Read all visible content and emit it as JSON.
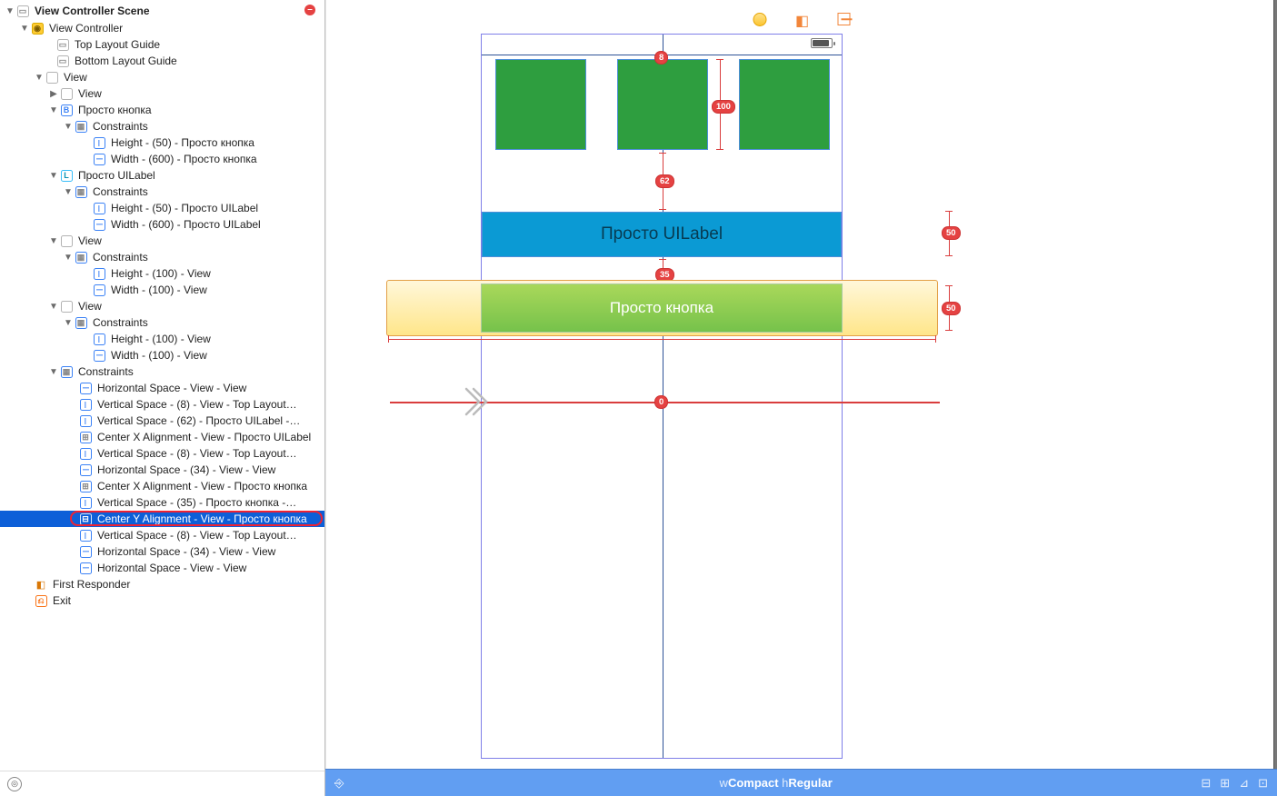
{
  "outline": {
    "scene_title": "View Controller Scene",
    "vc": "View Controller",
    "top_guide": "Top Layout Guide",
    "bottom_guide": "Bottom Layout Guide",
    "view": "View",
    "view_inner": "View",
    "button_item": "Просто кнопка",
    "constraints": "Constraints",
    "btn_c1": "Height - (50) - Просто кнопка",
    "btn_c2": "Width - (600) - Просто кнопка",
    "label_item": "Просто UILabel",
    "lbl_c1": "Height - (50) - Просто UILabel",
    "lbl_c2": "Width - (600) - Просто UILabel",
    "v3": "View",
    "v3_c1": "Height - (100) - View",
    "v3_c2": "Width - (100) - View",
    "v4": "View",
    "v4_c1": "Height - (100) - View",
    "v4_c2": "Width - (100) - View",
    "constraints2": "Constraints",
    "cc": [
      "Horizontal Space - View - View",
      "Vertical Space - (8) - View - Top Layout…",
      "Vertical Space - (62) - Просто UILabel -…",
      "Center X Alignment - View - Просто UILabel",
      "Vertical Space - (8) - View - Top Layout…",
      "Horizontal Space - (34) - View - View",
      "Center X Alignment - View - Просто кнопка",
      "Vertical Space - (35) - Просто кнопка -…",
      "Center Y Alignment - View - Просто кнопка",
      "Vertical Space - (8) - View - Top Layout…",
      "Horizontal Space - (34) - View - View",
      "Horizontal Space - View - View"
    ],
    "first_responder": "First Responder",
    "exit": "Exit"
  },
  "canvas": {
    "label_text": "Просто UILabel",
    "button_text": "Просто кнопка",
    "badge_8": "8",
    "badge_100": "100",
    "badge_62": "62",
    "badge_35": "35",
    "badge_0": "0",
    "badge_50a": "50",
    "badge_50b": "50"
  },
  "bottom": {
    "wlabel": "w",
    "wval": "Compact",
    "hlabel": " h",
    "hval": "Regular"
  }
}
